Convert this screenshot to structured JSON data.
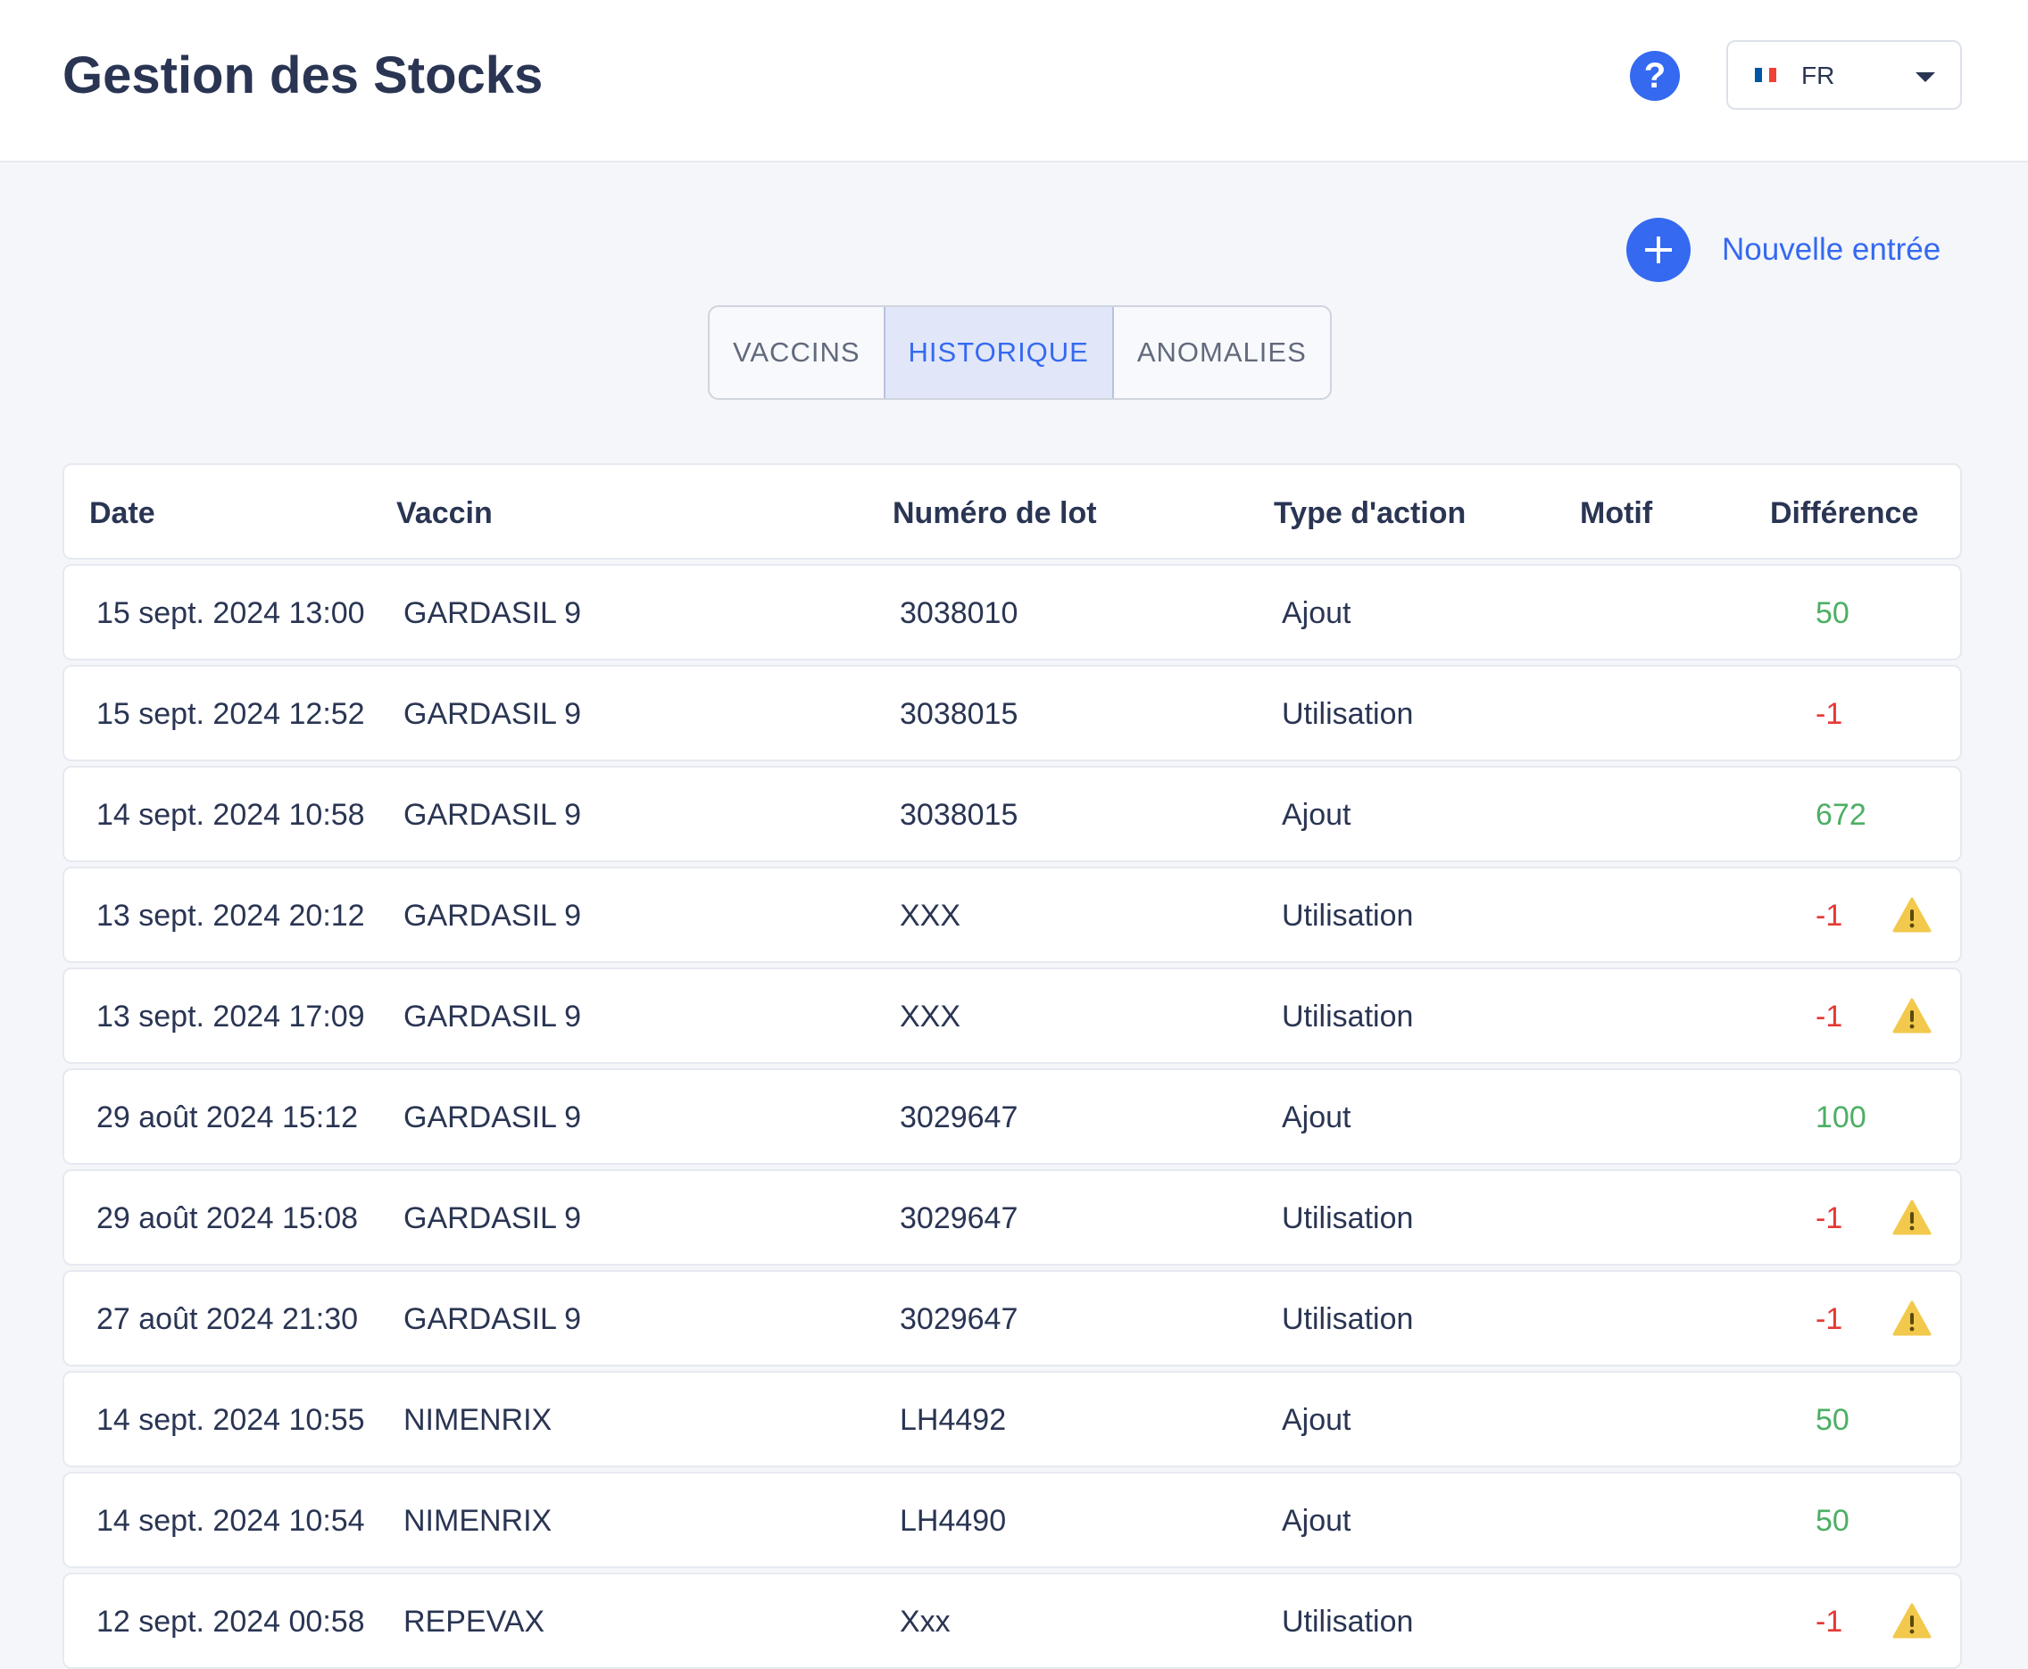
{
  "header": {
    "title": "Gestion des Stocks",
    "help_icon": "?",
    "language": {
      "selected": "FR",
      "flag_colors": [
        "#0055a4",
        "#ffffff",
        "#ef4135"
      ]
    }
  },
  "actions": {
    "new_entry_label": "Nouvelle entrée"
  },
  "tabs": [
    {
      "label": "VACCINS",
      "active": false
    },
    {
      "label": "HISTORIQUE",
      "active": true
    },
    {
      "label": "ANOMALIES",
      "active": false
    }
  ],
  "table": {
    "columns": [
      "Date",
      "Vaccin",
      "Numéro de lot",
      "Type d'action",
      "Motif",
      "Différence"
    ],
    "rows": [
      {
        "date": "15 sept. 2024 13:00",
        "vaccin": "GARDASIL 9",
        "lot": "3038010",
        "type": "Ajout",
        "motif": "",
        "diff": "50",
        "warning": false
      },
      {
        "date": "15 sept. 2024 12:52",
        "vaccin": "GARDASIL 9",
        "lot": "3038015",
        "type": "Utilisation",
        "motif": "",
        "diff": "-1",
        "warning": false
      },
      {
        "date": "14 sept. 2024 10:58",
        "vaccin": "GARDASIL 9",
        "lot": "3038015",
        "type": "Ajout",
        "motif": "",
        "diff": "672",
        "warning": false
      },
      {
        "date": "13 sept. 2024 20:12",
        "vaccin": "GARDASIL 9",
        "lot": "XXX",
        "type": "Utilisation",
        "motif": "",
        "diff": "-1",
        "warning": true
      },
      {
        "date": "13 sept. 2024 17:09",
        "vaccin": "GARDASIL 9",
        "lot": "XXX",
        "type": "Utilisation",
        "motif": "",
        "diff": "-1",
        "warning": true
      },
      {
        "date": "29 août 2024 15:12",
        "vaccin": "GARDASIL 9",
        "lot": "3029647",
        "type": "Ajout",
        "motif": "",
        "diff": "100",
        "warning": false
      },
      {
        "date": "29 août 2024 15:08",
        "vaccin": "GARDASIL 9",
        "lot": "3029647",
        "type": "Utilisation",
        "motif": "",
        "diff": "-1",
        "warning": true
      },
      {
        "date": "27 août 2024 21:30",
        "vaccin": "GARDASIL 9",
        "lot": "3029647",
        "type": "Utilisation",
        "motif": "",
        "diff": "-1",
        "warning": true
      },
      {
        "date": "14 sept. 2024 10:55",
        "vaccin": "NIMENRIX",
        "lot": "LH4492",
        "type": "Ajout",
        "motif": "",
        "diff": "50",
        "warning": false
      },
      {
        "date": "14 sept. 2024 10:54",
        "vaccin": "NIMENRIX",
        "lot": "LH4490",
        "type": "Ajout",
        "motif": "",
        "diff": "50",
        "warning": false
      },
      {
        "date": "12 sept. 2024 00:58",
        "vaccin": "REPEVAX",
        "lot": "Xxx",
        "type": "Utilisation",
        "motif": "",
        "diff": "-1",
        "warning": true
      }
    ]
  },
  "colors": {
    "accent": "#3569f0",
    "positive": "#4caf64",
    "negative": "#e53935",
    "warning": "#f2c94c"
  }
}
